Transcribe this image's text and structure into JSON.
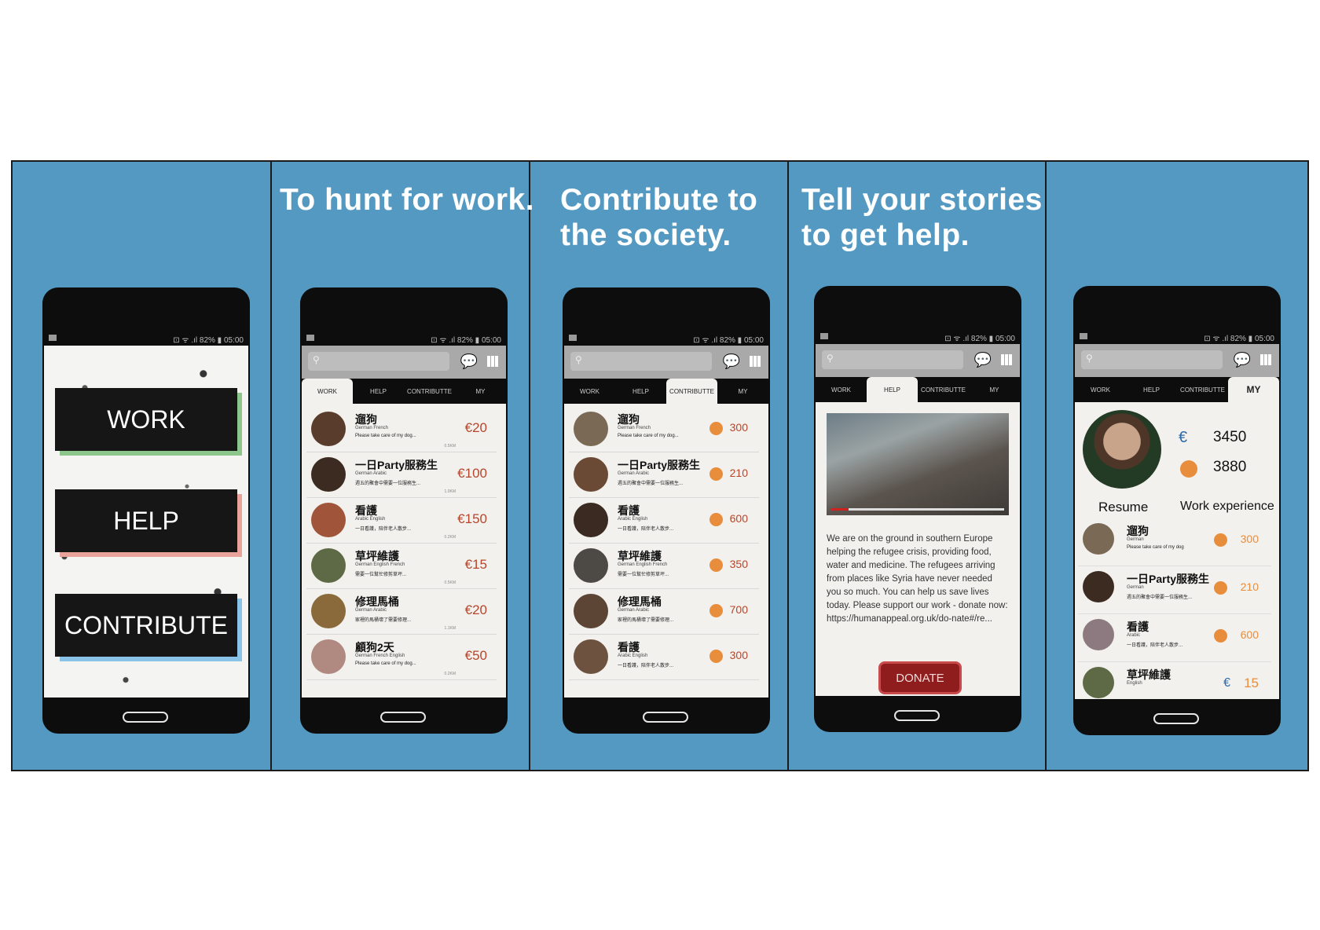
{
  "status": {
    "text": "⊡ ᯤ .ıl 82% ▮ 05:00"
  },
  "panel1": {
    "buttons": [
      "WORK",
      "HELP",
      "CONTRIBUTE"
    ]
  },
  "panel2": {
    "caption": "To hunt for work."
  },
  "panel3": {
    "caption": "Contribute to\nthe society."
  },
  "panel4": {
    "caption": "Tell your stories\nto get help."
  },
  "tabs": [
    "WORK",
    "HELP",
    "CONTRIBUTTE",
    "MY"
  ],
  "jobs": [
    {
      "title": "遛狗",
      "langs": "German  French",
      "desc": "Please take care of my dog...",
      "dist": "0.5KM",
      "price": "€20",
      "points": "300"
    },
    {
      "title": "一日Party服務生",
      "langs": "German  Arabic",
      "desc": "週五的聚會中需要一位服務生...",
      "dist": "1.0KM",
      "price": "€100",
      "points": "210"
    },
    {
      "title": "看護",
      "langs": "Arabic  English",
      "desc": "一日看護，陪伴老人散步...",
      "dist": "0.2KM",
      "price": "€150",
      "points": "600"
    },
    {
      "title": "草坪維護",
      "langs": "German  English  French",
      "desc": "需要一位幫忙修剪草坪...",
      "dist": "0.5KM",
      "price": "€15",
      "points": "350"
    },
    {
      "title": "修理馬桶",
      "langs": "German  Arabic",
      "desc": "家裡的馬桶壞了需要修理...",
      "dist": "1.1KM",
      "price": "€20",
      "points": "700"
    },
    {
      "title": "顧狗2天",
      "langs": "German  French  English",
      "desc": "Please take care of my dog...",
      "dist": "0.2KM",
      "price": "€50",
      "points": "300"
    }
  ],
  "contrib_last_title": "看護",
  "help": {
    "story": "We are on the ground in southern Europe helping the refugee crisis, providing food, water and medicine. The refugees arriving from places like Syria have never needed you so much. You can help us save lives today. Please support our work - donate now: https://humanappeal.org.uk/do-nate#/re...",
    "donate": "DONATE"
  },
  "my": {
    "euro_symbol": "€",
    "balance": "3450",
    "points": "3880",
    "resume": "Resume",
    "work_experience": "Work experience",
    "items": [
      {
        "title": "遛狗",
        "langs": "German",
        "desc": "Please take care of my dog",
        "value": "300",
        "kind": "points"
      },
      {
        "title": "一日Party服務生",
        "langs": "German",
        "desc": "週五的聚會中需要一位服務生...",
        "value": "210",
        "kind": "points"
      },
      {
        "title": "看護",
        "langs": "Arabic",
        "desc": "一日看護，陪伴老人散步...",
        "value": "600",
        "kind": "points"
      },
      {
        "title": "草坪維護",
        "langs": "English",
        "desc": "",
        "value": "15",
        "kind": "euro"
      }
    ]
  },
  "colors": {
    "panel_bg": "#5499c1",
    "accent_price": "#b5462b",
    "coin": "#e88d3c",
    "donate": "#8f1d1d",
    "euro": "#2d6aa8"
  }
}
